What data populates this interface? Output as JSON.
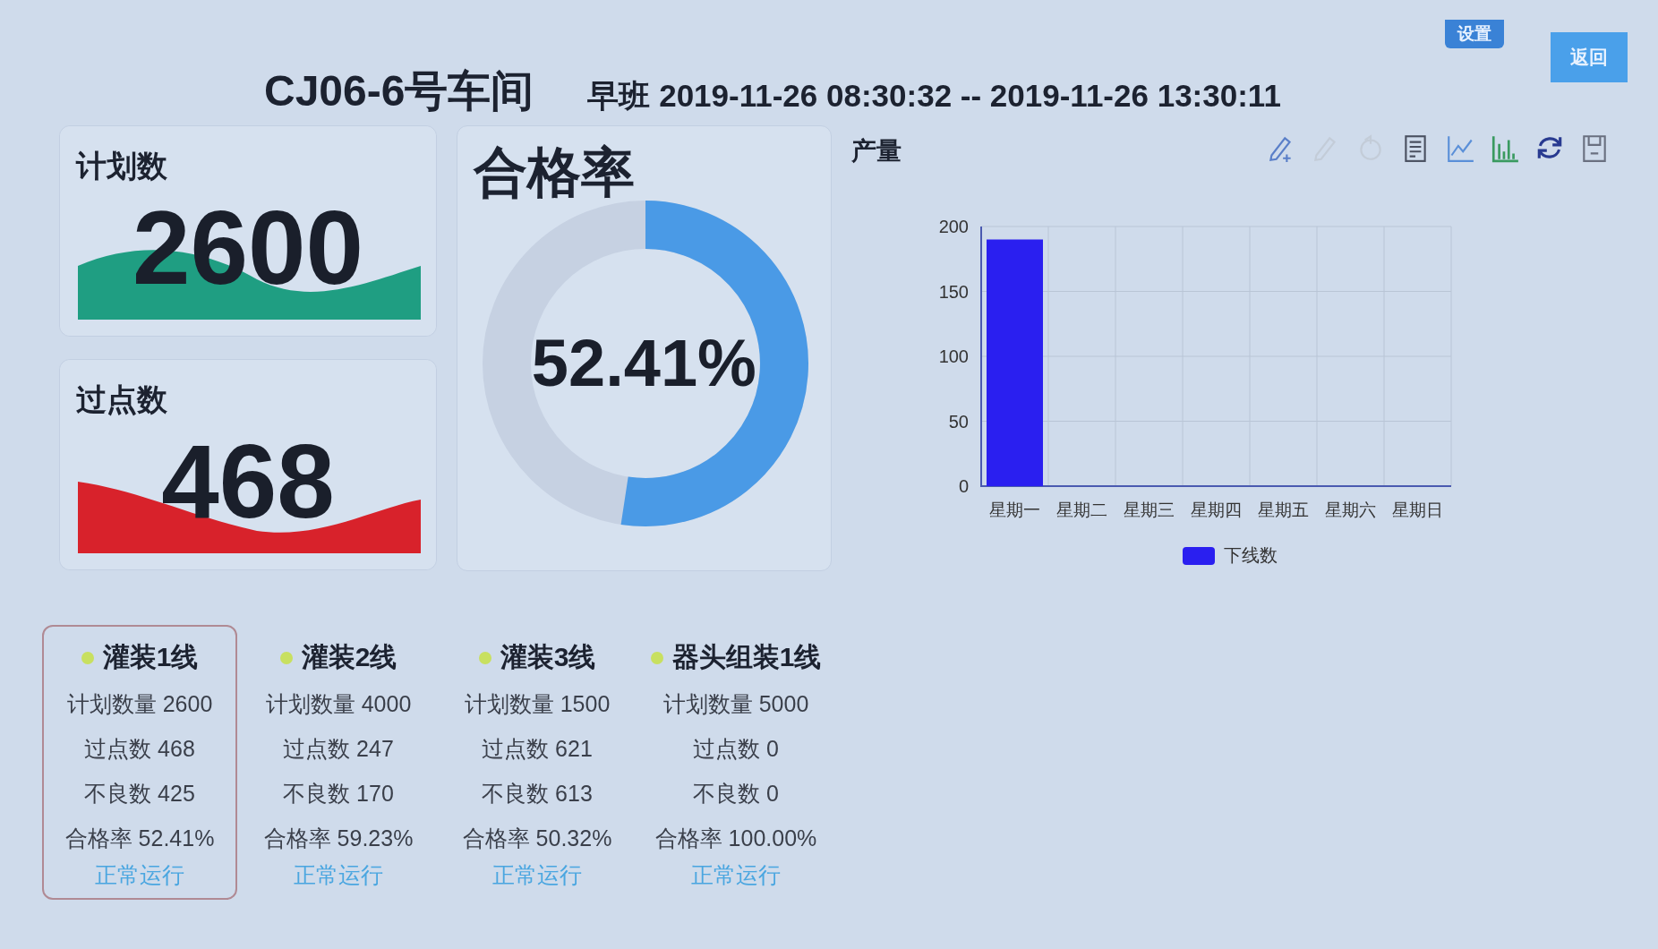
{
  "header": {
    "title": "CJ06-6号车间",
    "shift": "早班 2019-11-26 08:30:32 -- 2019-11-26 13:30:11"
  },
  "buttons": [
    {
      "label": "设置",
      "kind": "small"
    },
    {
      "label": "返回",
      "kind": "large"
    }
  ],
  "stat_cards": [
    {
      "label": "计划数",
      "value": "2600",
      "kind": "plan"
    },
    {
      "label": "过点数",
      "value": "468",
      "kind": "passed"
    }
  ],
  "pass_rate": {
    "label": "合格率",
    "value": "52.41%"
  },
  "output_chart": {
    "title": "产量",
    "toolbar": [
      {
        "kind": "pencil-plus",
        "disabled": false
      },
      {
        "kind": "pencil",
        "disabled": true
      },
      {
        "kind": "undo",
        "disabled": true
      },
      {
        "kind": "document",
        "disabled": false
      },
      {
        "kind": "line-chart",
        "disabled": false
      },
      {
        "kind": "bar-chart",
        "disabled": false
      },
      {
        "kind": "refresh",
        "disabled": false
      },
      {
        "kind": "save",
        "disabled": false
      }
    ],
    "chart_data": {
      "type": "bar",
      "categories": [
        "星期一",
        "星期二",
        "星期三",
        "星期四",
        "星期五",
        "星期六",
        "星期日"
      ],
      "series": [
        {
          "name": "下线数",
          "color": "#2a1ff0",
          "values": [
            190,
            0,
            0,
            0,
            0,
            0,
            0
          ]
        }
      ],
      "ylim": [
        0,
        200
      ],
      "grid": true,
      "yticks": [
        0,
        50,
        100,
        150,
        200
      ]
    }
  },
  "lines": [
    {
      "name": "灌装1线",
      "color": "#c8e060",
      "selected": true,
      "stats": [
        "计划数量 2600",
        "过点数 468",
        "不良数 425",
        "合格率 52.41%"
      ],
      "status": "正常运行"
    },
    {
      "name": "灌装2线",
      "color": "#c8e060",
      "selected": false,
      "stats": [
        "计划数量 4000",
        "过点数 247",
        "不良数 170",
        "合格率 59.23%"
      ],
      "status": "正常运行"
    },
    {
      "name": "灌装3线",
      "color": "#c8e060",
      "selected": false,
      "stats": [
        "计划数量 1500",
        "过点数 621",
        "不良数 613",
        "合格率 50.32%"
      ],
      "status": "正常运行"
    },
    {
      "name": "器头组装1线",
      "color": "#c8e060",
      "selected": false,
      "stats": [
        "计划数量 5000",
        "过点数 0",
        "不良数 0",
        "合格率 100.00%"
      ],
      "status": "正常运行"
    }
  ]
}
